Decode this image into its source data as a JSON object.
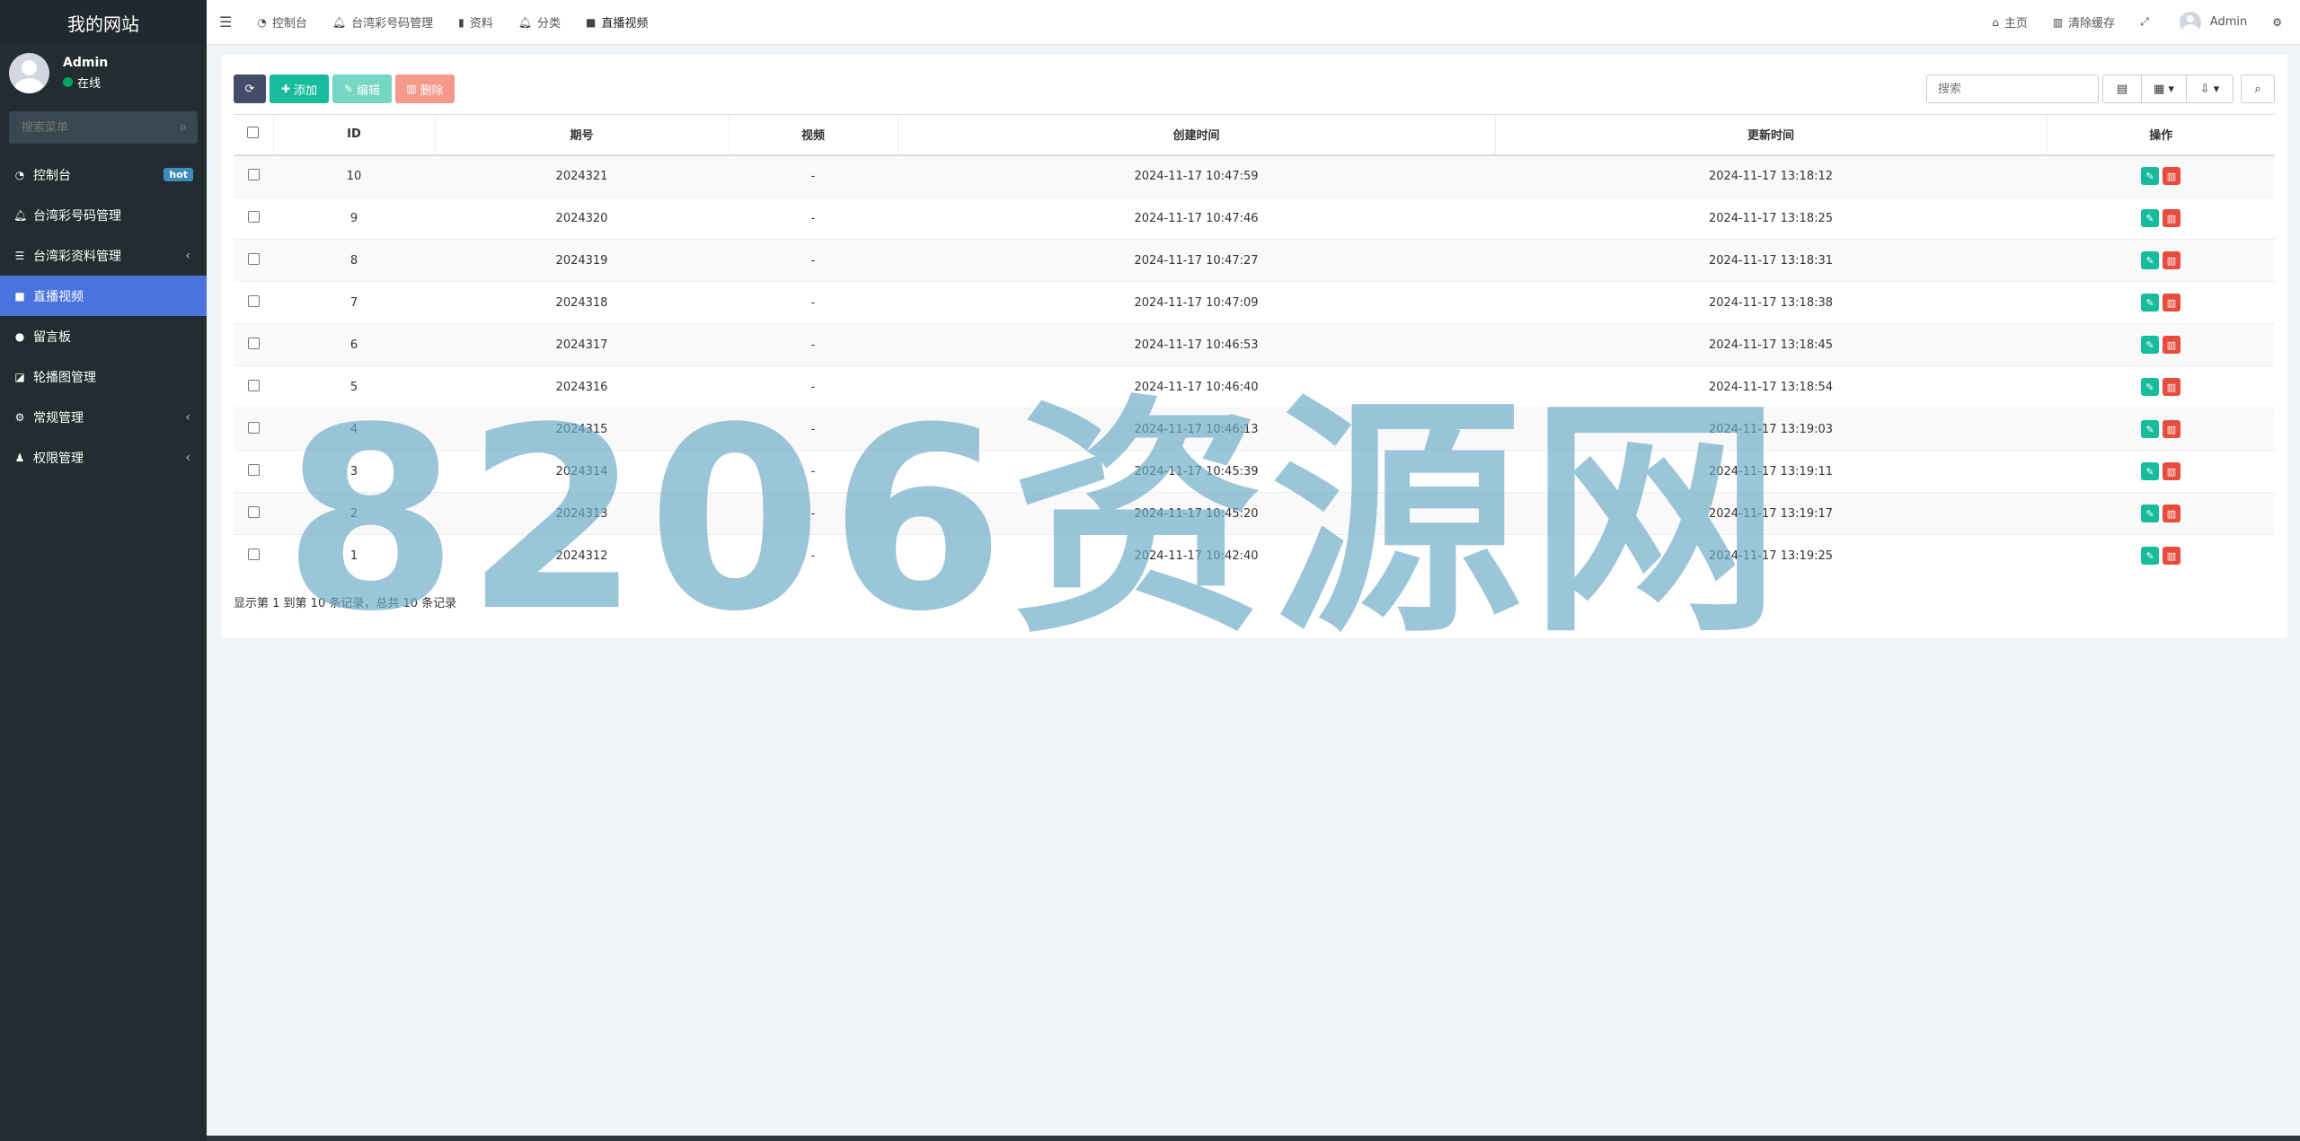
{
  "sidebar": {
    "brand": "我的网站",
    "user": {
      "name": "Admin",
      "status": "在线"
    },
    "search_placeholder": "搜索菜单",
    "items": [
      {
        "label": "控制台",
        "icon": "dashboard-icon",
        "badge": "hot"
      },
      {
        "label": "台湾彩号码管理",
        "icon": "bell-icon"
      },
      {
        "label": "台湾彩资料管理",
        "icon": "list-icon",
        "has_children": true
      },
      {
        "label": "直播视频",
        "icon": "video-icon",
        "active": true
      },
      {
        "label": "留言板",
        "icon": "comment-icon"
      },
      {
        "label": "轮播图管理",
        "icon": "image-icon"
      },
      {
        "label": "常规管理",
        "icon": "cogs-icon",
        "has_children": true
      },
      {
        "label": "权限管理",
        "icon": "users-icon",
        "has_children": true
      }
    ]
  },
  "topbar": {
    "tabs": [
      {
        "label": "控制台"
      },
      {
        "label": "台湾彩号码管理"
      },
      {
        "label": "资料"
      },
      {
        "label": "分类"
      },
      {
        "label": "直播视频",
        "active": true
      }
    ],
    "home": "主页",
    "clear_cache": "清除缓存",
    "user": "Admin"
  },
  "toolbar": {
    "add": "添加",
    "edit": "编辑",
    "delete": "删除",
    "search_placeholder": "搜索"
  },
  "table": {
    "headers": [
      "ID",
      "期号",
      "视频",
      "创建时间",
      "更新时间",
      "操作"
    ],
    "rows": [
      {
        "id": "10",
        "issue": "2024321",
        "video": "-",
        "created": "2024-11-17 10:47:59",
        "updated": "2024-11-17 13:18:12"
      },
      {
        "id": "9",
        "issue": "2024320",
        "video": "-",
        "created": "2024-11-17 10:47:46",
        "updated": "2024-11-17 13:18:25"
      },
      {
        "id": "8",
        "issue": "2024319",
        "video": "-",
        "created": "2024-11-17 10:47:27",
        "updated": "2024-11-17 13:18:31"
      },
      {
        "id": "7",
        "issue": "2024318",
        "video": "-",
        "created": "2024-11-17 10:47:09",
        "updated": "2024-11-17 13:18:38"
      },
      {
        "id": "6",
        "issue": "2024317",
        "video": "-",
        "created": "2024-11-17 10:46:53",
        "updated": "2024-11-17 13:18:45"
      },
      {
        "id": "5",
        "issue": "2024316",
        "video": "-",
        "created": "2024-11-17 10:46:40",
        "updated": "2024-11-17 13:18:54"
      },
      {
        "id": "4",
        "issue": "2024315",
        "video": "-",
        "created": "2024-11-17 10:46:13",
        "updated": "2024-11-17 13:19:03"
      },
      {
        "id": "3",
        "issue": "2024314",
        "video": "-",
        "created": "2024-11-17 10:45:39",
        "updated": "2024-11-17 13:19:11"
      },
      {
        "id": "2",
        "issue": "2024313",
        "video": "-",
        "created": "2024-11-17 10:45:20",
        "updated": "2024-11-17 13:19:17"
      },
      {
        "id": "1",
        "issue": "2024312",
        "video": "-",
        "created": "2024-11-17 10:42:40",
        "updated": "2024-11-17 13:19:25"
      }
    ]
  },
  "pagination_info": "显示第 1 到第 10 条记录，总共 10 条记录",
  "watermark": "8206资源网",
  "colors": {
    "sidebar_bg": "#222d32",
    "active": "#4a73df",
    "success": "#18bc9c",
    "danger": "#e74c3c",
    "primary_dark": "#444c69"
  }
}
